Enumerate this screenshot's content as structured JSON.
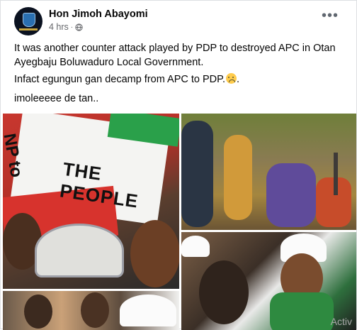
{
  "post": {
    "author": "Hon Jimoh Abayomi",
    "time": "4 hrs",
    "dot": "·",
    "more": "•••",
    "text_line1": "It was another counter attack played by PDP to destroyed APC in Otan Ayegbaju Boluwaduro Local Government.",
    "text_line2": "Infact egungun gan decamp from APC to PDP.",
    "text_line3": "imoleeeee de tan..",
    "flag_text1": "NP to",
    "flag_text2": "THE PEOPLE",
    "watermark": "Activ"
  },
  "icons": {
    "privacy": "globe-icon",
    "more": "more-options-icon",
    "emoji": "worried-face-icon"
  },
  "colors": {
    "pdp_red": "#d7332d",
    "pdp_green": "#2aa04a",
    "meta_grey": "#65676b"
  }
}
